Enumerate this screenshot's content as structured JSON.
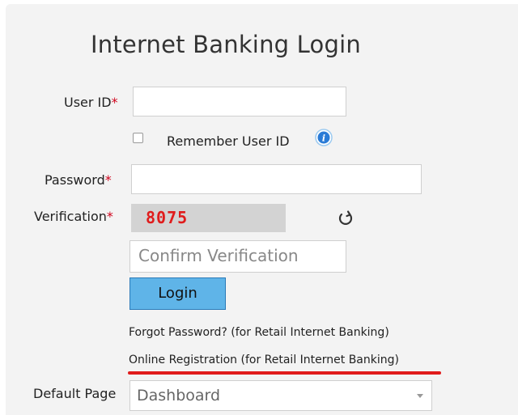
{
  "page": {
    "title": "Internet Banking Login"
  },
  "form": {
    "user_id_label": "User ID",
    "required_mark": "*",
    "remember_label": "Remember User ID",
    "password_label": "Password",
    "verification_label": "Verification",
    "captcha_code": "8075",
    "confirm_placeholder": "Confirm Verification",
    "login_label": "Login",
    "forgot_link": "Forgot Password? (for Retail Internet Banking)",
    "registration_link": "Online Registration (for Retail Internet Banking)",
    "default_page_label": "Default Page",
    "default_page_value": "Dashboard"
  },
  "icons": {
    "info": "info-icon",
    "refresh": "refresh-icon",
    "dropdown": "chevron-down-icon"
  },
  "colors": {
    "required": "#d0021b",
    "captcha_text": "#e01c1c",
    "login_button": "#5fb4e8",
    "highlight_underline": "#e01c1c"
  }
}
